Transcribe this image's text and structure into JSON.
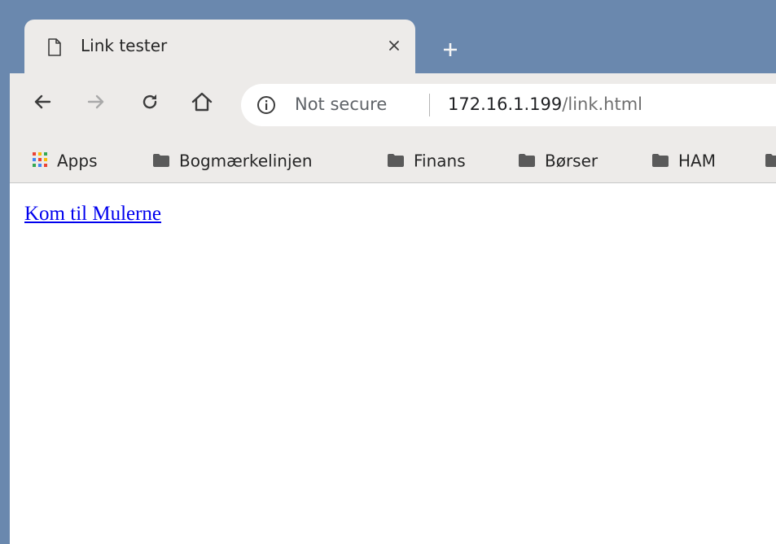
{
  "tab": {
    "title": "Link tester",
    "page_icon": "page-icon",
    "close_icon": "close-icon"
  },
  "new_tab": {
    "icon": "plus-icon"
  },
  "toolbar": {
    "back_icon": "arrow-left-icon",
    "forward_icon": "arrow-right-icon",
    "reload_icon": "reload-icon",
    "home_icon": "home-icon"
  },
  "omnibox": {
    "security_icon": "info-icon",
    "security_text": "Not secure",
    "url_host": "172.16.1.199",
    "url_path": "/link.html"
  },
  "bookmarks": {
    "apps_label": "Apps",
    "items": [
      {
        "label": "Bogmærkelinjen",
        "icon": "folder-icon"
      },
      {
        "label": "Finans",
        "icon": "folder-icon"
      },
      {
        "label": "Børser",
        "icon": "folder-icon"
      },
      {
        "label": "HAM",
        "icon": "folder-icon"
      }
    ]
  },
  "content": {
    "link_text": "Kom til Mulerne"
  },
  "colors": {
    "frame": "#6a88ae",
    "toolbar": "#edebe9",
    "link": "#0000ee"
  }
}
